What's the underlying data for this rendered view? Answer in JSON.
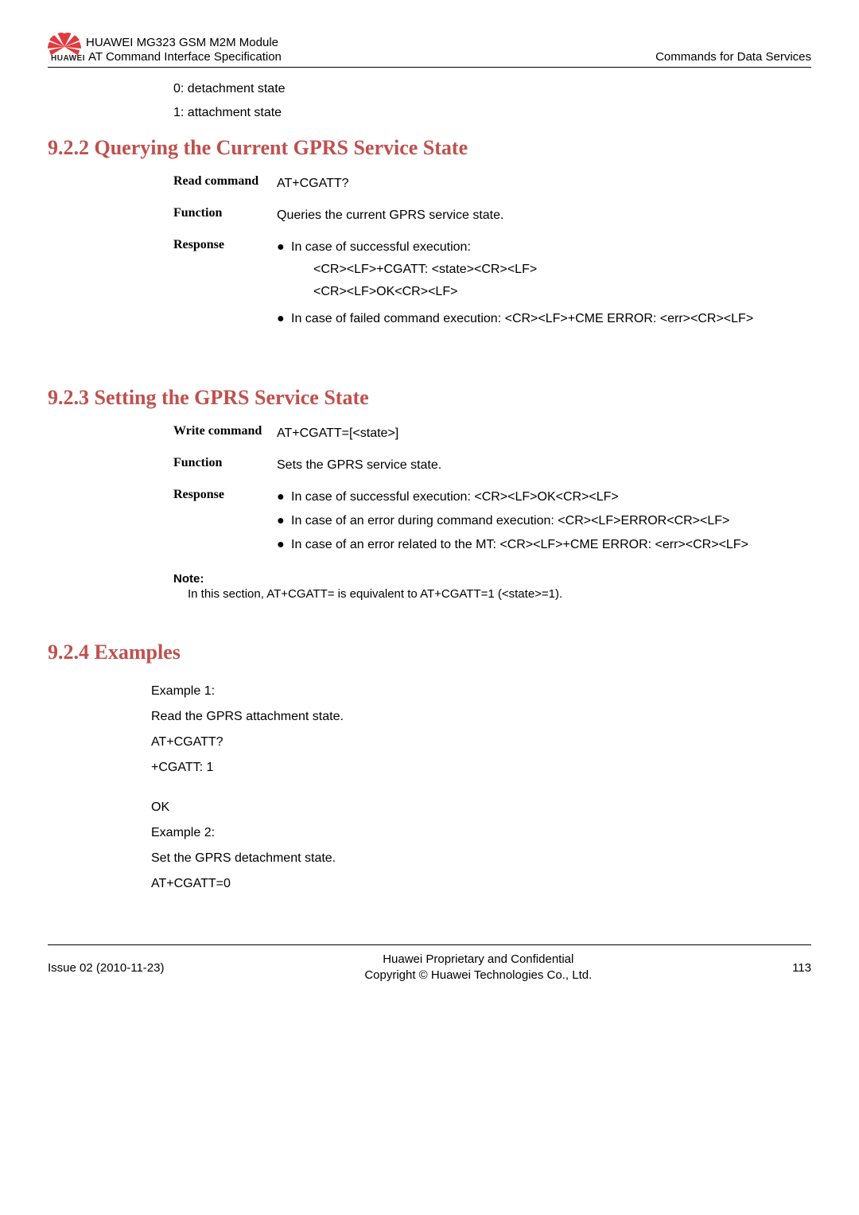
{
  "header": {
    "line1": "HUAWEI MG323 GSM M2M Module",
    "line2": "AT Command Interface Specification",
    "right": "Commands for Data Services",
    "huawei_label": "HUAWEI"
  },
  "intro": {
    "line1": "0: detachment state",
    "line2": "1: attachment state"
  },
  "sec922": {
    "title": "9.2.2 Querying the Current GPRS Service State",
    "rows": {
      "read_label": "Read command",
      "read_val": "AT+CGATT?",
      "func_label": "Function",
      "func_val": "Queries the current GPRS service state.",
      "resp_label": "Response",
      "resp_b1_line1": "In case of successful execution:",
      "resp_b1_sub1": "<CR><LF>+CGATT: <state><CR><LF>",
      "resp_b1_sub2": "<CR><LF>OK<CR><LF>",
      "resp_b2": "In case of failed command execution: <CR><LF>+CME ERROR: <err><CR><LF>"
    }
  },
  "sec923": {
    "title": "9.2.3 Setting the GPRS Service State",
    "rows": {
      "write_label": "Write command",
      "write_val": "AT+CGATT=[<state>]",
      "func_label": "Function",
      "func_val": "Sets the GPRS service state.",
      "resp_label": "Response",
      "resp_b1": "In case of successful execution: <CR><LF>OK<CR><LF>",
      "resp_b2": "In case of an error during command execution: <CR><LF>ERROR<CR><LF>",
      "resp_b3": "In case of an error related to the MT: <CR><LF>+CME ERROR: <err><CR><LF>"
    },
    "note_label": "Note:",
    "note_text": "In this section, AT+CGATT= is equivalent to AT+CGATT=1 (<state>=1)."
  },
  "sec924": {
    "title": "9.2.4 Examples",
    "lines": {
      "ex1_label": "Example 1:",
      "ex1_l1": "Read the GPRS attachment state.",
      "ex1_l2": "AT+CGATT?",
      "ex1_l3": "+CGATT: 1",
      "ok": "OK",
      "ex2_label": "Example 2:",
      "ex2_l1": "Set the GPRS detachment state.",
      "ex2_l2": "AT+CGATT=0"
    }
  },
  "footer": {
    "left": "Issue 02 (2010-11-23)",
    "center1": "Huawei Proprietary and Confidential",
    "center2": "Copyright © Huawei Technologies Co., Ltd.",
    "right": "113"
  }
}
